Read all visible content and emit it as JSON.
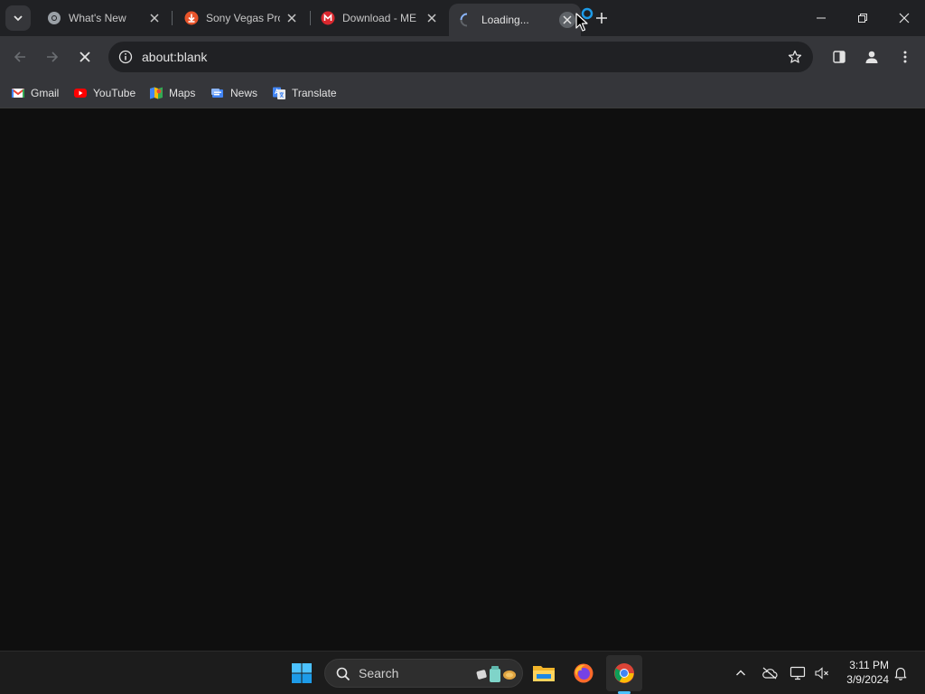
{
  "browser": {
    "tabs": [
      {
        "title": "What's New",
        "favicon": "chrome-icon",
        "active": false
      },
      {
        "title": "Sony Vegas Pro",
        "favicon": "download-icon",
        "active": false
      },
      {
        "title": "Download - ME",
        "favicon": "mega-icon",
        "active": false
      },
      {
        "title": "Loading...",
        "favicon": "loading-spinner-icon",
        "active": true
      }
    ],
    "url": "about:blank",
    "bookmarks": [
      {
        "label": "Gmail",
        "icon": "gmail-icon"
      },
      {
        "label": "YouTube",
        "icon": "youtube-icon"
      },
      {
        "label": "Maps",
        "icon": "maps-icon"
      },
      {
        "label": "News",
        "icon": "news-icon"
      },
      {
        "label": "Translate",
        "icon": "translate-icon"
      }
    ]
  },
  "taskbar": {
    "search_label": "Search",
    "time": "3:11 PM",
    "date": "3/9/2024",
    "apps": [
      "start-icon",
      "file-explorer-icon",
      "firefox-icon",
      "chrome-icon"
    ]
  },
  "colors": {
    "tabstrip": "#202124",
    "toolbar": "#35363a",
    "content": "#0f0f0f",
    "taskbar": "#1c1c1c",
    "accent": "#4cc2ff"
  }
}
